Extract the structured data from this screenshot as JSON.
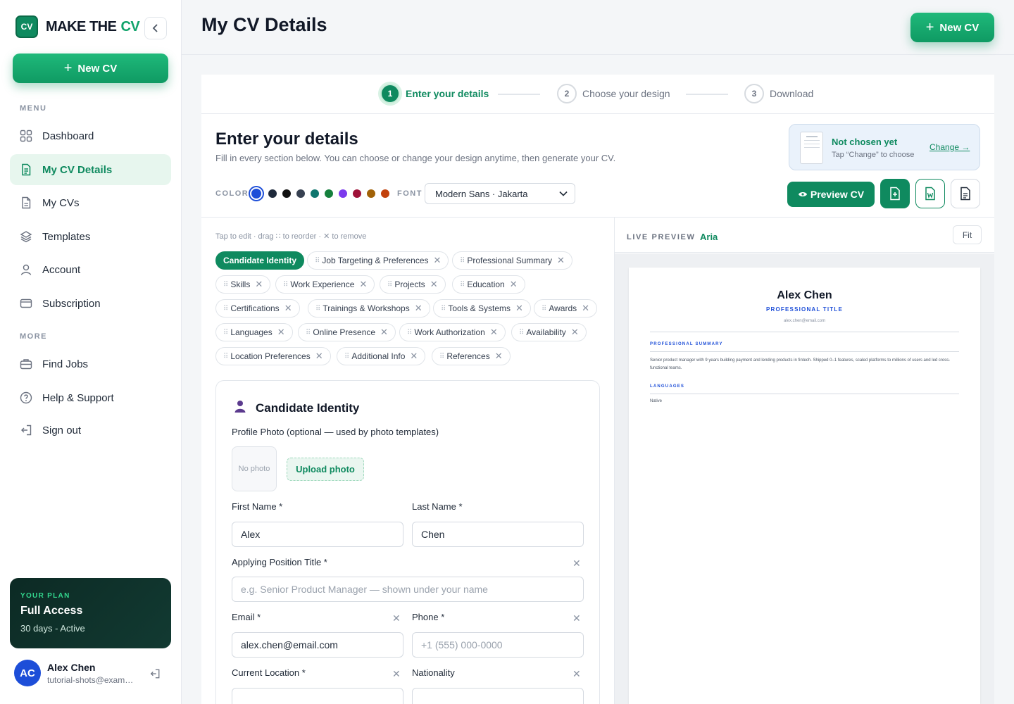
{
  "brand": {
    "logo_text": "CV",
    "name": "MAKE THE",
    "accent": "CV"
  },
  "sidebar": {
    "new_cv": "New CV",
    "menu_label": "MENU",
    "more_label": "MORE",
    "items": [
      {
        "label": "Dashboard",
        "icon": "grid-icon"
      },
      {
        "label": "My CV Details",
        "icon": "document-icon"
      },
      {
        "label": "My CVs",
        "icon": "file-icon"
      },
      {
        "label": "Templates",
        "icon": "layers-icon"
      },
      {
        "label": "Account",
        "icon": "user-icon"
      },
      {
        "label": "Subscription",
        "icon": "card-icon"
      }
    ],
    "more_items": [
      {
        "label": "Find Jobs",
        "icon": "briefcase-icon"
      },
      {
        "label": "Help & Support",
        "icon": "help-icon"
      },
      {
        "label": "Sign out",
        "icon": "signout-icon"
      }
    ],
    "plan": {
      "tag": "YOUR PLAN",
      "name": "Full Access",
      "status": "30 days - Active"
    },
    "user": {
      "initials": "AC",
      "name": "Alex Chen",
      "email": "tutorial-shots@example.com"
    }
  },
  "topbar": {
    "title": "My CV Details",
    "new_cv": "New CV"
  },
  "stepper": [
    {
      "num": "1",
      "label": "Enter your details",
      "active": true
    },
    {
      "num": "2",
      "label": "Choose your design",
      "active": false
    },
    {
      "num": "3",
      "label": "Download",
      "active": false
    }
  ],
  "details": {
    "title": "Enter your details",
    "subtitle": "Fill in every section below. You can choose or change your design anytime, then generate your CV.",
    "design": {
      "status": "Not chosen yet",
      "hint": "Tap “Change” to choose",
      "change": "Change →"
    },
    "color_label": "COLOR",
    "font_label": "FONT",
    "font_value": "Modern Sans · Jakarta",
    "colors": [
      "#1d4ed8",
      "#1e293b",
      "#111111",
      "#374151",
      "#0f766e",
      "#15803d",
      "#7c3aed",
      "#9f1239",
      "#a16207",
      "#c2410c"
    ],
    "preview_btn": "Preview CV"
  },
  "sections": {
    "tip": "Tap to edit · drag ∷ to reorder · ✕ to remove",
    "chips": [
      "Candidate Identity",
      "Job Targeting & Preferences",
      "Professional Summary",
      "Skills",
      "Work Experience",
      "Projects",
      "Education",
      "Certifications",
      "Trainings & Workshops",
      "Tools & Systems",
      "Awards",
      "Languages",
      "Online Presence",
      "Work Authorization",
      "Availability",
      "Location Preferences",
      "Additional Info",
      "References"
    ]
  },
  "form": {
    "title": "Candidate Identity",
    "photo_label": "Profile Photo (optional — used by photo templates)",
    "no_photo": "No photo",
    "upload": "Upload photo",
    "first_name_label": "First Name *",
    "first_name": "Alex",
    "last_name_label": "Last Name *",
    "last_name": "Chen",
    "position_label": "Applying Position Title *",
    "position_placeholder": "e.g. Senior Product Manager — shown under your name",
    "email_label": "Email *",
    "email": "alex.chen@email.com",
    "phone_label": "Phone *",
    "phone_placeholder": "+1 (555) 000-0000",
    "location_label": "Current Location *",
    "nationality_label": "Nationality"
  },
  "preview": {
    "label": "LIVE PREVIEW",
    "template": "Aria",
    "fit": "Fit",
    "cv": {
      "name": "Alex Chen",
      "title": "PROFESSIONAL TITLE",
      "email": "alex.chen@email.com",
      "summary_heading": "PROFESSIONAL SUMMARY",
      "summary": "Senior product manager with 9 years building payment and lending products in fintech. Shipped 0–1 features, scaled platforms to millions of users and led cross-functional teams.",
      "languages_heading": "LANGUAGES",
      "languages": "Native"
    }
  }
}
